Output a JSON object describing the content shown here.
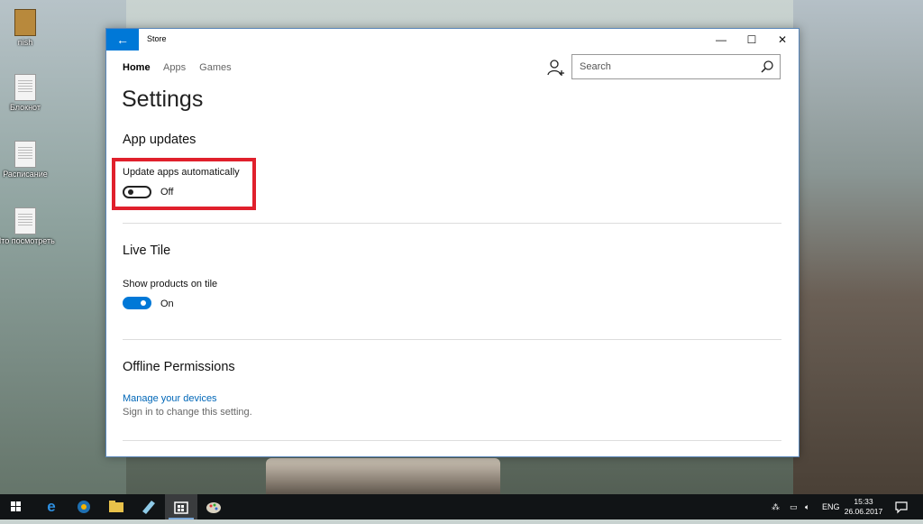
{
  "desktop": {
    "icons": [
      {
        "label": "nish",
        "icon": "photo-file-icon"
      },
      {
        "label": "Блокнот",
        "icon": "text-file-icon"
      },
      {
        "label": "Расписание",
        "icon": "text-file-icon"
      },
      {
        "label": "Что посмотреть",
        "icon": "text-file-icon"
      }
    ]
  },
  "window": {
    "title": "Store",
    "back_icon": "back-arrow-icon",
    "controls": {
      "minimize": "—",
      "maximize": "☐",
      "close": "✕"
    }
  },
  "nav": {
    "tabs": [
      {
        "label": "Home",
        "active": true
      },
      {
        "label": "Apps",
        "active": false
      },
      {
        "label": "Games",
        "active": false
      }
    ]
  },
  "search": {
    "placeholder": "Search",
    "value": ""
  },
  "settings": {
    "title": "Settings",
    "app_updates": {
      "heading": "App updates",
      "setting_label": "Update apps automatically",
      "toggle_state": "Off"
    },
    "live_tile": {
      "heading": "Live Tile",
      "setting_label": "Show products on tile",
      "toggle_state": "On"
    },
    "offline": {
      "heading": "Offline Permissions",
      "link": "Manage your devices",
      "note": "Sign in to change this setting."
    }
  },
  "taskbar": {
    "items": [
      "start-icon",
      "edge-icon",
      "browser-icon",
      "file-explorer-icon",
      "mail-icon",
      "store-icon",
      "paint-icon"
    ],
    "tray": {
      "language": "ENG",
      "time": "15:33",
      "date": "26.06.2017"
    }
  },
  "colors": {
    "accent": "#0078d7",
    "highlight": "#e0202c",
    "link": "#0067b8"
  }
}
